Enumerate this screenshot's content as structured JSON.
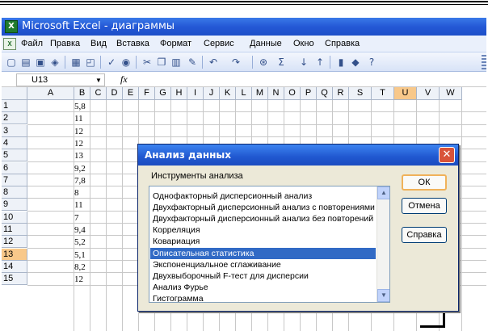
{
  "window": {
    "title": "Microsoft Excel - диаграммы"
  },
  "menu": {
    "items": [
      "Файл",
      "Правка",
      "Вид",
      "Вставка",
      "Формат",
      "Сервис",
      "Данные",
      "Окно",
      "Справка"
    ]
  },
  "toolbar": {
    "icons": [
      "new-icon",
      "open-icon",
      "save-icon",
      "permission-icon",
      "print-icon",
      "print-preview-icon",
      "spelling-icon",
      "research-icon",
      "cut-icon",
      "copy-icon",
      "paste-icon",
      "format-painter-icon",
      "undo-icon",
      "redo-icon",
      "hyperlink-icon",
      "autosum-icon",
      "sort-ascending-icon",
      "sort-descending-icon",
      "chart-wizard-icon",
      "drawing-icon",
      "help-icon"
    ]
  },
  "formula_bar": {
    "name_box": "U13",
    "fx_label": "fx"
  },
  "sheet": {
    "columns": [
      "A",
      "B",
      "C",
      "D",
      "E",
      "F",
      "G",
      "H",
      "I",
      "J",
      "K",
      "L",
      "M",
      "N",
      "O",
      "P",
      "Q",
      "R",
      "S",
      "T",
      "U",
      "V",
      "W"
    ],
    "selected_column": "U",
    "rows": [
      "1",
      "2",
      "3",
      "4",
      "5",
      "6",
      "7",
      "8",
      "9",
      "10",
      "11",
      "12",
      "13",
      "14",
      "15"
    ],
    "selected_row": "13",
    "column_b_values": [
      "5,8",
      "11",
      "12",
      "12",
      "13",
      "9,2",
      "7,8",
      "8",
      "11",
      "7",
      "9,4",
      "5,2",
      "5,1",
      "8,2",
      "12"
    ]
  },
  "dialog": {
    "title": "Анализ данных",
    "tools_label": "Инструменты анализа",
    "items": [
      "Однофакторный дисперсионный анализ",
      "Двухфакторный дисперсионный анализ с повторениями",
      "Двухфакторный дисперсионный анализ без повторений",
      "Корреляция",
      "Ковариация",
      "Описательная статистика",
      "Экспоненциальное сглаживание",
      "Двухвыборочный F-тест для дисперсии",
      "Анализ Фурье",
      "Гистограмма"
    ],
    "selected_item": "Описательная статистика",
    "buttons": {
      "ok": "ОК",
      "cancel": "Отмена",
      "help": "Справка"
    }
  }
}
